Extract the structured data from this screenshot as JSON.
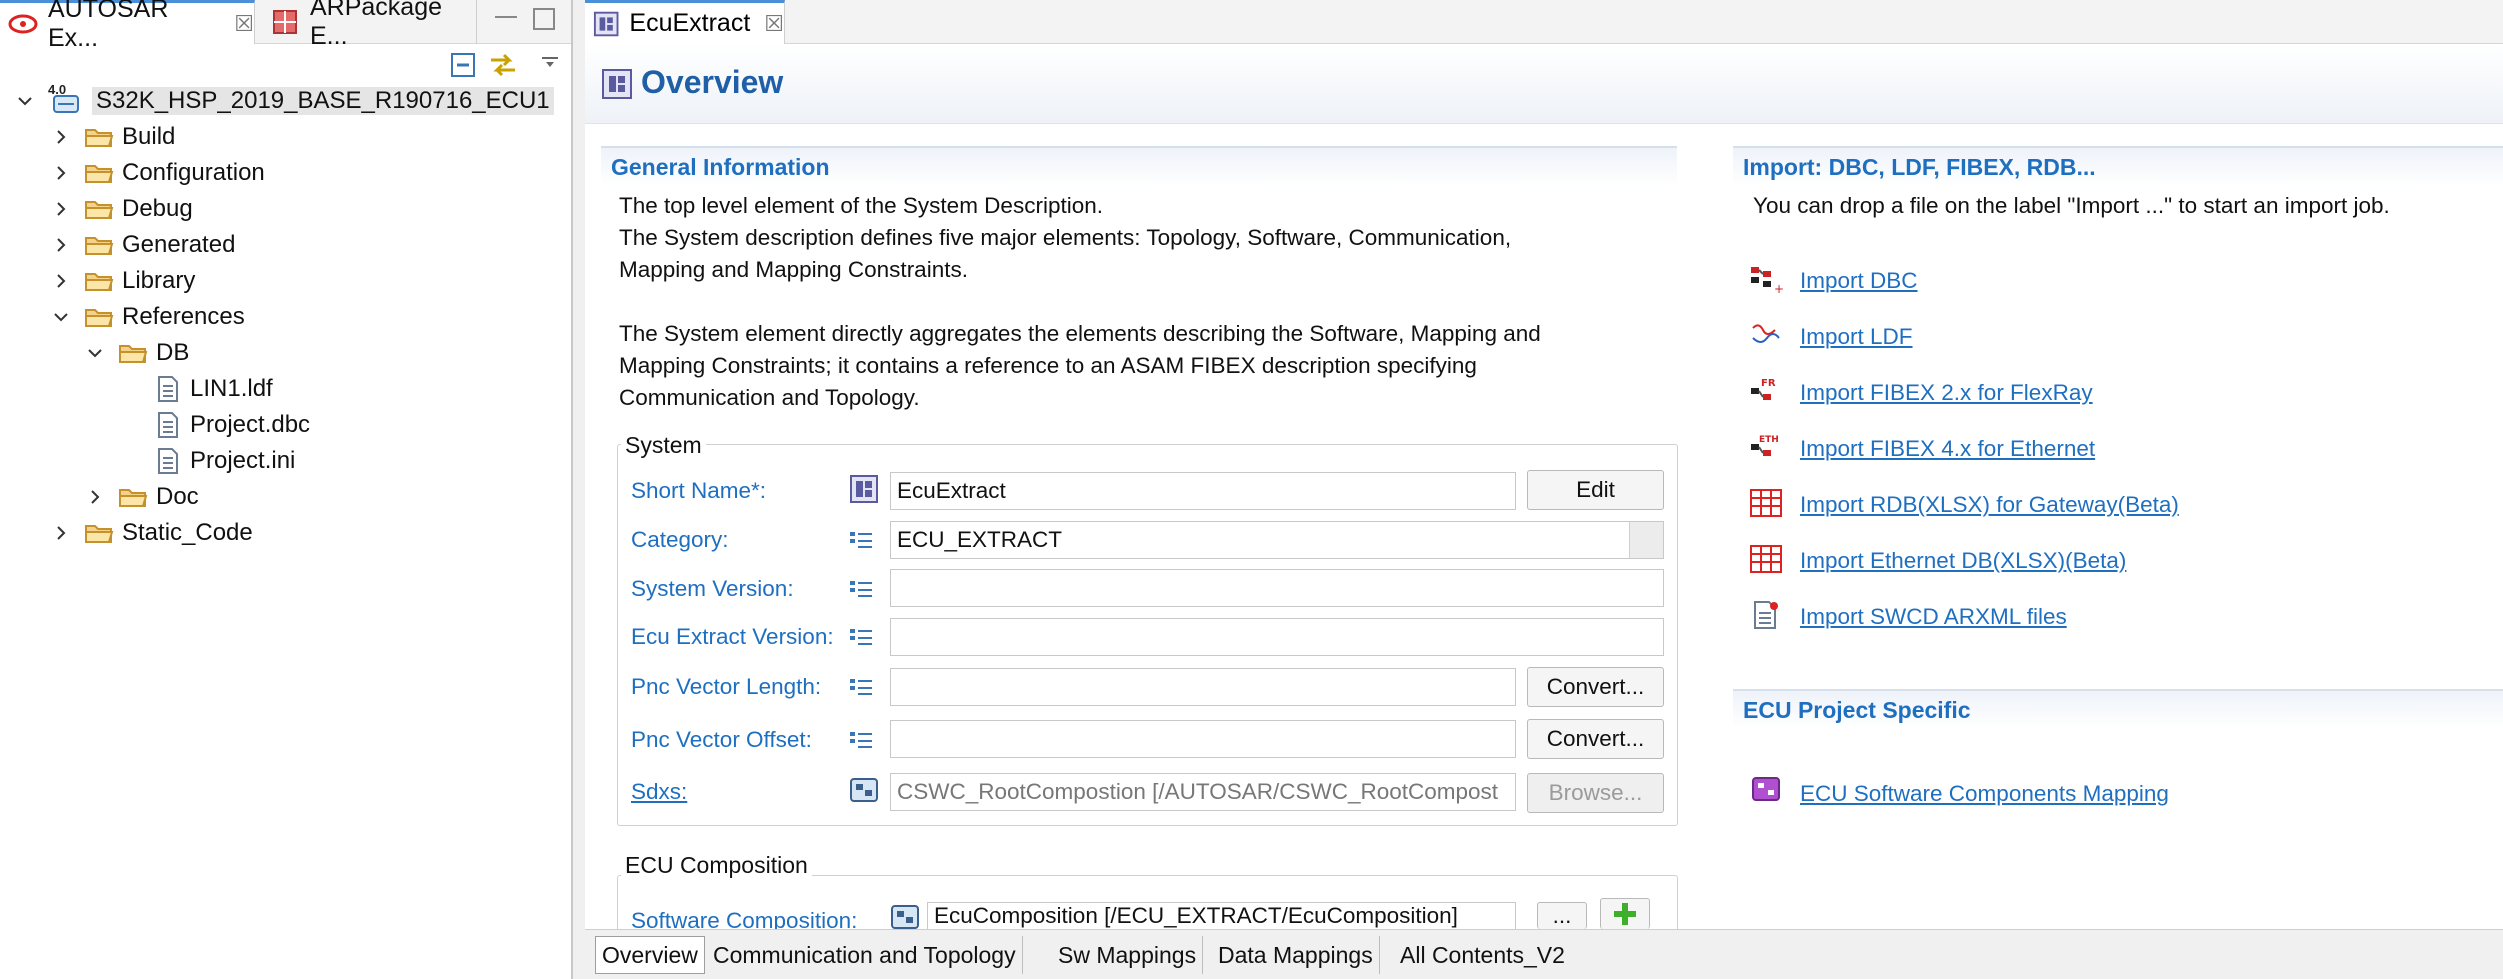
{
  "left_panel": {
    "tabs": [
      {
        "label": "AUTOSAR Ex...",
        "close": "☒"
      },
      {
        "label": "ARPackage E..."
      }
    ],
    "tree": {
      "root": "S32K_HSP_2019_BASE_R190716_ECU1",
      "root_badge": "4.0",
      "items": [
        {
          "label": "Build"
        },
        {
          "label": "Configuration"
        },
        {
          "label": "Debug"
        },
        {
          "label": "Generated"
        },
        {
          "label": "Library"
        },
        {
          "label": "References"
        },
        {
          "label": "DB"
        },
        {
          "label": "LIN1.ldf"
        },
        {
          "label": "Project.dbc"
        },
        {
          "label": "Project.ini"
        },
        {
          "label": "Doc"
        },
        {
          "label": "Static_Code"
        }
      ]
    }
  },
  "editor": {
    "tab_label": "EcuExtract",
    "tab_close": "☒",
    "title": "Overview",
    "general": {
      "heading": "General Information",
      "p1": "The top level element of the System Description.",
      "p2": "The System description defines five major elements: Topology, Software, Communication,",
      "p3": "Mapping and Mapping Constraints.",
      "p4": "The System element directly aggregates the elements describing the Software, Mapping and",
      "p5": "Mapping Constraints; it contains a reference to an ASAM FIBEX description specifying",
      "p6": "Communication and Topology."
    },
    "system": {
      "group_title": "System",
      "short_name_label": "Short Name*:",
      "short_name_value": "EcuExtract",
      "edit_button": "Edit",
      "category_label": "Category:",
      "category_value": "ECU_EXTRACT",
      "system_version_label": "System Version:",
      "ecu_extract_version_label": "Ecu Extract Version:",
      "pnc_length_label": "Pnc Vector Length:",
      "pnc_offset_label": "Pnc Vector Offset:",
      "convert_button": "Convert...",
      "sdxs_label": "Sdxs:",
      "sdxs_value": "CSWC_RootCompostion [/AUTOSAR/CSWC_RootCompost",
      "browse_button": "Browse..."
    },
    "ecu_composition": {
      "group_title": "ECU Composition",
      "software_label": "Software Composition:",
      "software_value": "EcuComposition [/ECU_EXTRACT/EcuComposition]",
      "dots_button": "...",
      "add_button": "+"
    },
    "import": {
      "heading": "Import: DBC, LDF, FIBEX, RDB...",
      "hint": "You can drop a file on the label \"Import ...\" to start an import job.",
      "links": [
        {
          "label": "Import DBC",
          "icon": "dbc-icon"
        },
        {
          "label": "Import LDF",
          "icon": "ldf-icon"
        },
        {
          "label": "Import FIBEX 2.x for FlexRay",
          "icon": "flexray-icon",
          "badge": "FR"
        },
        {
          "label": "Import FIBEX 4.x for Ethernet",
          "icon": "ethernet-icon",
          "badge": "ETH"
        },
        {
          "label": "Import RDB(XLSX) for Gateway(Beta)",
          "icon": "spreadsheet-icon"
        },
        {
          "label": "Import Ethernet DB(XLSX)(Beta)",
          "icon": "spreadsheet-icon"
        },
        {
          "label": "Import SWCD ARXML files",
          "icon": "arxml-file-icon"
        }
      ]
    },
    "ecu_project": {
      "heading": "ECU Project Specific",
      "link": "ECU Software Components Mapping"
    },
    "bottom_tabs": [
      {
        "label": "Overview"
      },
      {
        "label": "Communication and Topology"
      },
      {
        "label": "Sw Mappings"
      },
      {
        "label": "Data Mappings"
      },
      {
        "label": "All Contents_V2"
      }
    ]
  },
  "colors": {
    "link": "#1f6fc0",
    "title": "#1f5fa8",
    "accent": "#4a90d9"
  }
}
